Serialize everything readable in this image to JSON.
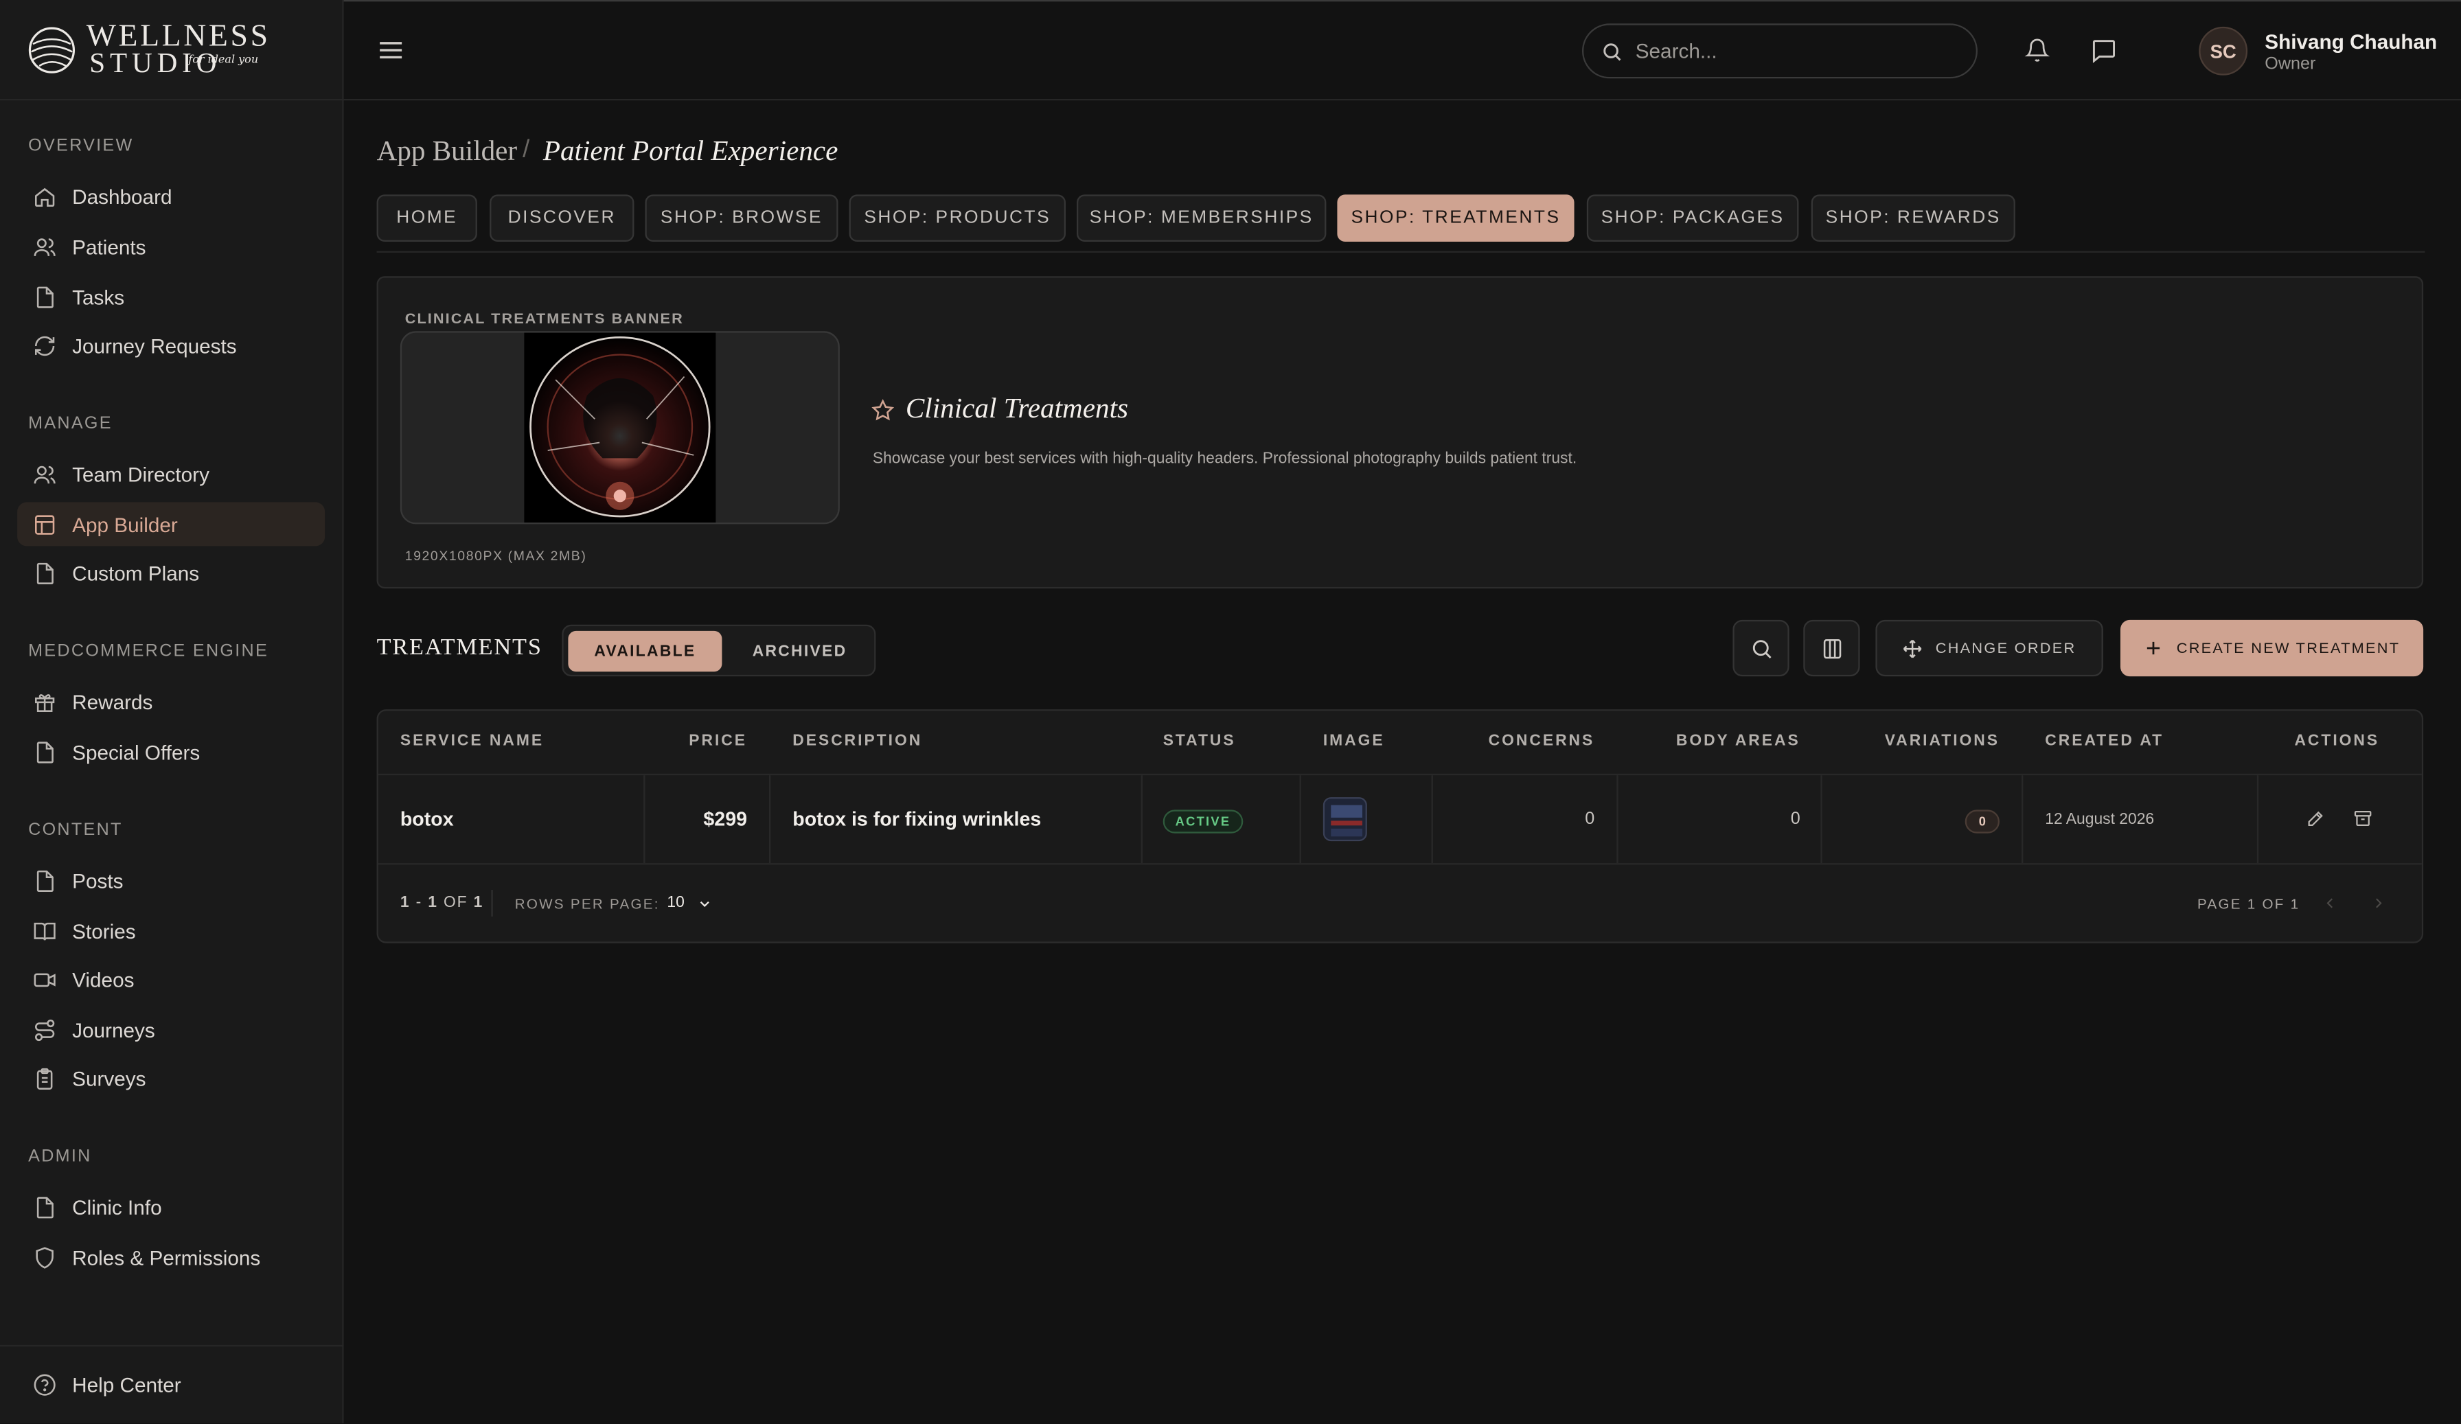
{
  "brand": {
    "word1": "WELLNESS",
    "word2": "STUDIO",
    "tagline": "for ideal you"
  },
  "sidebar": {
    "sections": [
      {
        "title": "OVERVIEW",
        "items": [
          {
            "label": "Dashboard",
            "icon": "home-icon"
          },
          {
            "label": "Patients",
            "icon": "users-icon"
          },
          {
            "label": "Tasks",
            "icon": "file-icon"
          },
          {
            "label": "Journey Requests",
            "icon": "refresh-icon"
          }
        ]
      },
      {
        "title": "MANAGE",
        "items": [
          {
            "label": "Team Directory",
            "icon": "users-icon"
          },
          {
            "label": "App Builder",
            "icon": "layout-icon",
            "active": true
          },
          {
            "label": "Custom Plans",
            "icon": "file-icon"
          }
        ]
      },
      {
        "title": "MEDCOMMERCE ENGINE",
        "items": [
          {
            "label": "Rewards",
            "icon": "gift-icon"
          },
          {
            "label": "Special Offers",
            "icon": "file-icon"
          }
        ]
      },
      {
        "title": "CONTENT",
        "items": [
          {
            "label": "Posts",
            "icon": "file-icon"
          },
          {
            "label": "Stories",
            "icon": "book-icon"
          },
          {
            "label": "Videos",
            "icon": "video-icon"
          },
          {
            "label": "Journeys",
            "icon": "route-icon"
          },
          {
            "label": "Surveys",
            "icon": "clipboard-icon"
          }
        ]
      },
      {
        "title": "ADMIN",
        "items": [
          {
            "label": "Clinic Info",
            "icon": "file-icon"
          },
          {
            "label": "Roles & Permissions",
            "icon": "shield-icon"
          }
        ]
      }
    ],
    "help": "Help Center"
  },
  "header": {
    "search_placeholder": "Search...",
    "user_initials": "SC",
    "user_name": "Shivang Chauhan",
    "user_role": "Owner"
  },
  "breadcrumb": {
    "root": "App Builder",
    "sep": "/",
    "current": "Patient Portal Experience"
  },
  "tabs": [
    {
      "label": "HOME"
    },
    {
      "label": "DISCOVER"
    },
    {
      "label": "SHOP: BROWSE"
    },
    {
      "label": "SHOP: PRODUCTS"
    },
    {
      "label": "SHOP: MEMBERSHIPS"
    },
    {
      "label": "SHOP: TREATMENTS",
      "active": true
    },
    {
      "label": "SHOP: PACKAGES"
    },
    {
      "label": "SHOP: REWARDS"
    }
  ],
  "banner": {
    "label": "CLINICAL TREATMENTS BANNER",
    "size_hint": "1920X1080PX (MAX 2MB)",
    "title": "Clinical Treatments",
    "description": "Showcase your best services with high-quality headers. Professional photography builds patient trust."
  },
  "treatments": {
    "title": "TREATMENTS",
    "filter_available": "AVAILABLE",
    "filter_archived": "ARCHIVED",
    "change_order": "CHANGE ORDER",
    "create": "CREATE NEW TREATMENT",
    "columns": [
      "SERVICE NAME",
      "PRICE",
      "DESCRIPTION",
      "STATUS",
      "IMAGE",
      "CONCERNS",
      "BODY AREAS",
      "VARIATIONS",
      "CREATED AT",
      "ACTIONS"
    ],
    "rows": [
      {
        "name": "botox",
        "price": "$299",
        "description": "botox is for fixing wrinkles",
        "status": "ACTIVE",
        "concerns": "0",
        "body_areas": "0",
        "variations": "0",
        "created_at": "12 August 2026"
      }
    ],
    "pagination": {
      "range_a": "1",
      "range_dash": " - ",
      "range_b": "1",
      "range_of": " OF ",
      "range_total": "1",
      "rows_label": "ROWS PER PAGE:",
      "rows_value": "10",
      "page_label": "PAGE 1 OF 1"
    }
  },
  "colors": {
    "accent": "#cfa391",
    "active_green": "#66c985",
    "background": "#121212",
    "sidebar": "#1a1a1a"
  }
}
